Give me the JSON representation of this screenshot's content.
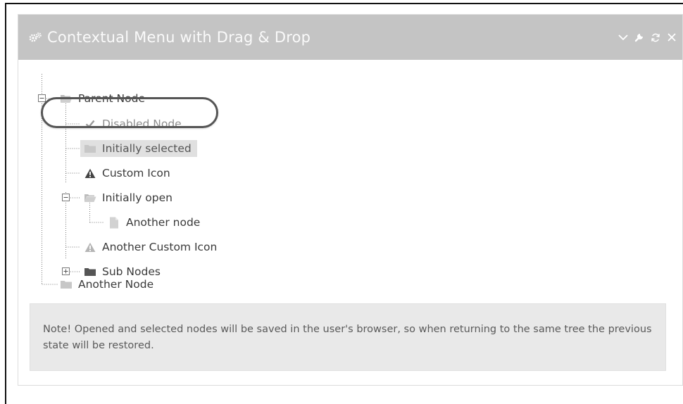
{
  "widget": {
    "title": "Contextual Menu with Drag & Drop",
    "title_icon": "cogs-icon",
    "toolbar": [
      {
        "name": "collapse-button",
        "icon": "chevron-down-icon"
      },
      {
        "name": "settings-button",
        "icon": "wrench-icon"
      },
      {
        "name": "refresh-button",
        "icon": "refresh-icon"
      },
      {
        "name": "close-button",
        "icon": "close-icon"
      }
    ]
  },
  "tree": {
    "nodes": [
      {
        "label": "Parent Node",
        "icon": "folder-open-icon",
        "state": "open"
      },
      {
        "label": "Disabled Node",
        "icon": "check-icon",
        "state": "disabled"
      },
      {
        "label": "Initially selected",
        "icon": "folder-icon",
        "state": "selected"
      },
      {
        "label": "Custom Icon",
        "icon": "warning-icon",
        "state": "normal"
      },
      {
        "label": "Initially open",
        "icon": "folder-open-icon",
        "state": "open"
      },
      {
        "label": "Another node",
        "icon": "file-icon",
        "state": "normal"
      },
      {
        "label": "Another Custom Icon",
        "icon": "warning-icon",
        "state": "normal"
      },
      {
        "label": "Sub Nodes",
        "icon": "folder-icon",
        "state": "closed"
      },
      {
        "label": "Another Node",
        "icon": "folder-icon",
        "state": "normal"
      }
    ]
  },
  "note": {
    "text": "Note! Opened and selected nodes will be saved in the user's browser, so when returning to the same tree the previous state will be restored."
  },
  "colors": {
    "header_bg": "#c4c4c4",
    "header_text": "#fafafa",
    "note_bg": "#e9e9e9",
    "selected_bg": "#e0e0e0",
    "highlight_ring": "#555555"
  }
}
